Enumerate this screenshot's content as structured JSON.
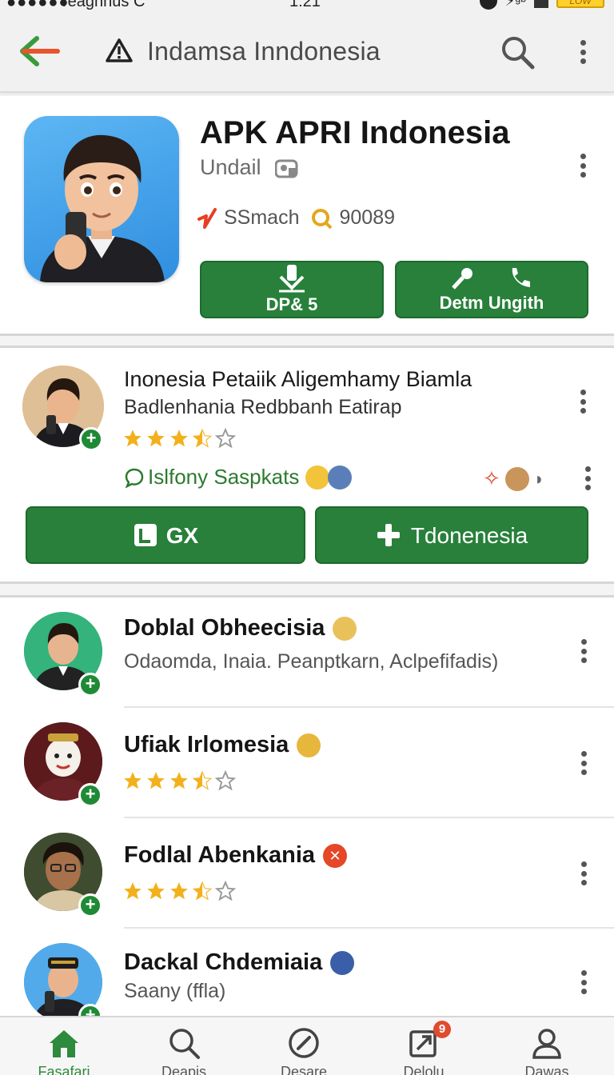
{
  "status_bar": {
    "signal": "●●●●●●",
    "carrier": "reaghnus  C",
    "time": "1:21",
    "battery_label": "LOW"
  },
  "app_bar": {
    "title": "Indamsa Inndonesia",
    "accent": "#e8542c"
  },
  "header_app": {
    "title": "APK APRI Indonesia",
    "developer": "Undail",
    "meta_left": "SSmach",
    "meta_right": "90089",
    "primary_button": "DP& 5",
    "secondary_button": "Detm Ungith",
    "button_color": "#28803a"
  },
  "featured": {
    "title": "Inonesia Petaiik Aligemhamy Biamla",
    "subtitle": "Badlenhania Redbbanh Eatirap",
    "rating": 3.5,
    "tag": "Islfony Saspkats",
    "button_left": "GX",
    "button_right": "Tdonenesia"
  },
  "list": [
    {
      "title": "Doblal Obheecisia",
      "subtitle": "Odaomda, Inaia. Peanptkarn, Aclpefifadis)",
      "rating": null,
      "badge": "emoji"
    },
    {
      "title": "Ufiak Irlomesia",
      "subtitle": "",
      "rating": 3.5,
      "badge": "emoji"
    },
    {
      "title": "Fodlal Abenkania",
      "subtitle": "",
      "rating": 3.5,
      "badge": "close"
    },
    {
      "title": "Dackal Chdemiaia",
      "subtitle": "Saany (ffla)",
      "rating": null,
      "badge": "emoji"
    }
  ],
  "bottom_nav": [
    {
      "label": "Fasafari",
      "icon": "home-icon",
      "active": true
    },
    {
      "label": "Deapis",
      "icon": "search-icon",
      "active": false
    },
    {
      "label": "Desare",
      "icon": "compass-icon",
      "active": false
    },
    {
      "label": "Delolu",
      "icon": "updates-icon",
      "active": false,
      "badge": "9"
    },
    {
      "label": "Dawas",
      "icon": "profile-icon",
      "active": false
    }
  ]
}
